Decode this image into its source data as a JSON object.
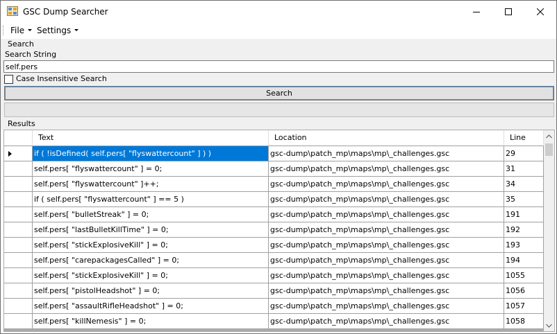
{
  "window": {
    "title": "GSC Dump Searcher",
    "icon": "app-icon"
  },
  "menu": {
    "items": [
      {
        "label": "File"
      },
      {
        "label": "Settings"
      }
    ]
  },
  "search": {
    "group_label": "Search",
    "string_label": "Search String",
    "value": "self.pers",
    "case_insensitive_label": "Case Insensitive Search",
    "case_insensitive_checked": false,
    "button_label": "Search",
    "progress": 0
  },
  "results": {
    "label": "Results",
    "columns": [
      "Text",
      "Location",
      "Line"
    ],
    "rows": [
      {
        "text": "if ( !isDefined( self.pers[ \"flyswattercount\" ] ) )",
        "location": "gsc-dump\\patch_mp\\maps\\mp\\_challenges.gsc",
        "line": "29"
      },
      {
        "text": "self.pers[ \"flyswattercount\" ] = 0;",
        "location": "gsc-dump\\patch_mp\\maps\\mp\\_challenges.gsc",
        "line": "31"
      },
      {
        "text": "self.pers[ \"flyswattercount\" ]++;",
        "location": "gsc-dump\\patch_mp\\maps\\mp\\_challenges.gsc",
        "line": "34"
      },
      {
        "text": "if ( self.pers[ \"flyswattercount\" ] == 5 )",
        "location": "gsc-dump\\patch_mp\\maps\\mp\\_challenges.gsc",
        "line": "35"
      },
      {
        "text": "self.pers[ \"bulletStreak\" ] = 0;",
        "location": "gsc-dump\\patch_mp\\maps\\mp\\_challenges.gsc",
        "line": "191"
      },
      {
        "text": "self.pers[ \"lastBulletKillTime\" ] = 0;",
        "location": "gsc-dump\\patch_mp\\maps\\mp\\_challenges.gsc",
        "line": "192"
      },
      {
        "text": "self.pers[ \"stickExplosiveKill\" ] = 0;",
        "location": "gsc-dump\\patch_mp\\maps\\mp\\_challenges.gsc",
        "line": "193"
      },
      {
        "text": "self.pers[ \"carepackagesCalled\" ] = 0;",
        "location": "gsc-dump\\patch_mp\\maps\\mp\\_challenges.gsc",
        "line": "194"
      },
      {
        "text": "self.pers[ \"stickExplosiveKill\" ] = 0;",
        "location": "gsc-dump\\patch_mp\\maps\\mp\\_challenges.gsc",
        "line": "1055"
      },
      {
        "text": "self.pers[ \"pistolHeadshot\" ] = 0;",
        "location": "gsc-dump\\patch_mp\\maps\\mp\\_challenges.gsc",
        "line": "1056"
      },
      {
        "text": "self.pers[ \"assaultRifleHeadshot\" ] = 0;",
        "location": "gsc-dump\\patch_mp\\maps\\mp\\_challenges.gsc",
        "line": "1057"
      },
      {
        "text": "self.pers[ \"killNemesis\" ] = 0;",
        "location": "gsc-dump\\patch_mp\\maps\\mp\\_challenges.gsc",
        "line": "1058"
      }
    ],
    "selected_row": 0
  },
  "colors": {
    "selection": "#0078d7",
    "panel": "#f0f0f0",
    "grid_line": "#a0a0a0"
  }
}
